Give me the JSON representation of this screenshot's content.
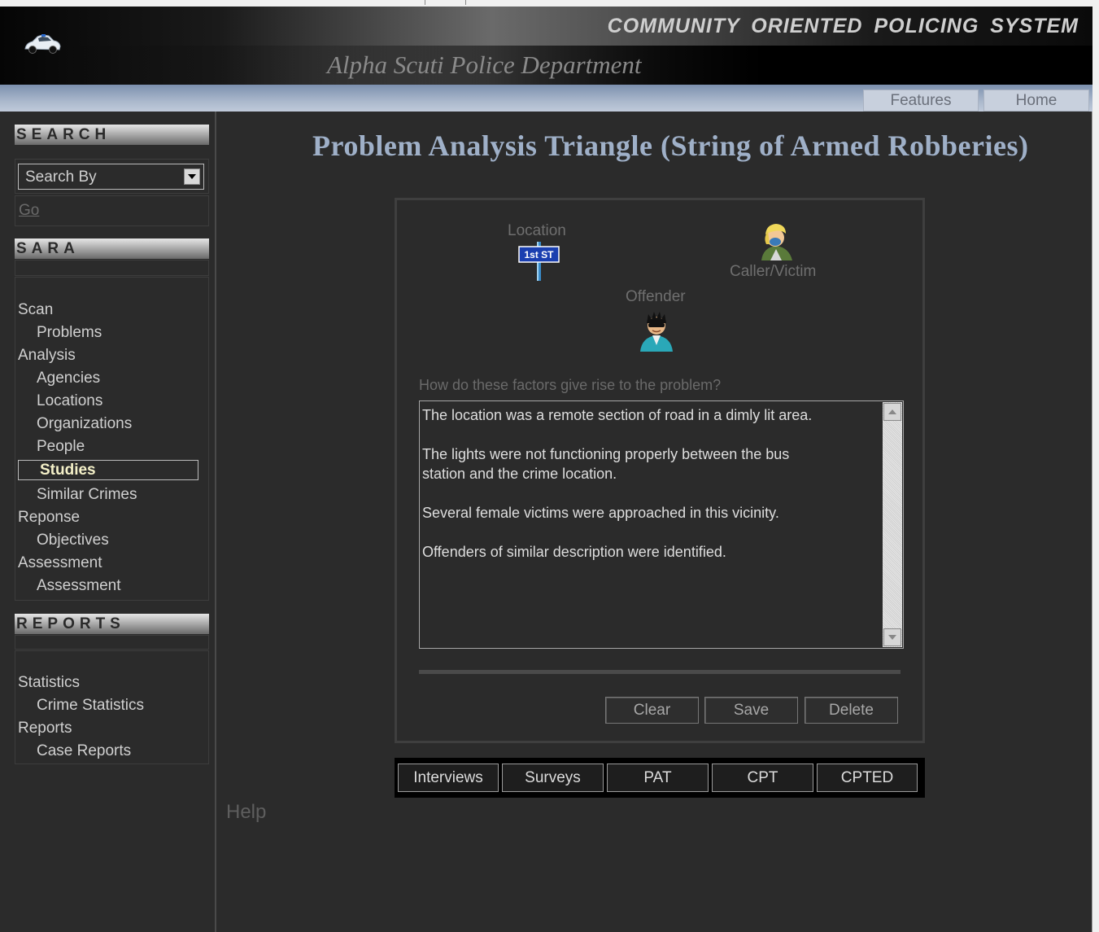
{
  "header": {
    "app_title": "COMMUNITY  ORIENTED  POLICING  SYSTEM",
    "department": "Alpha Scuti Police Department",
    "car_icon": "police-car-icon"
  },
  "nav": {
    "features": "Features",
    "home": "Home"
  },
  "sidebar": {
    "search_heading": "SEARCH",
    "search_select_value": "Search By",
    "go_label": "Go",
    "sara_heading": "SARA",
    "sara_items": [
      {
        "label": "Scan",
        "level": 0
      },
      {
        "label": "Problems",
        "level": 1
      },
      {
        "label": "Analysis",
        "level": 0
      },
      {
        "label": "Agencies",
        "level": 1
      },
      {
        "label": "Locations",
        "level": 1
      },
      {
        "label": "Organizations",
        "level": 1
      },
      {
        "label": "People",
        "level": 1
      },
      {
        "label": "Studies",
        "level": 1,
        "active": true
      },
      {
        "label": "Similar Crimes",
        "level": 1
      },
      {
        "label": "Reponse",
        "level": 0
      },
      {
        "label": "Objectives",
        "level": 1
      },
      {
        "label": "Assessment",
        "level": 0
      },
      {
        "label": "Assessment",
        "level": 1
      }
    ],
    "reports_heading": "REPORTS",
    "report_items": [
      {
        "label": "Statistics",
        "level": 0
      },
      {
        "label": "Crime Statistics",
        "level": 1
      },
      {
        "label": "Reports",
        "level": 0
      },
      {
        "label": "Case Reports",
        "level": 1
      }
    ]
  },
  "main": {
    "title": "Problem Analysis Triangle (String of Armed Robberies)",
    "triangle": {
      "location_label": "Location",
      "location_sign": "1st ST",
      "victim_label": "Caller/Victim",
      "offender_label": "Offender"
    },
    "question": "How do these factors give rise to the problem?",
    "answer_paragraphs": [
      "The location was a remote section of road in a dimly lit area.",
      "The lights were not functioning properly between the bus\nstation and the crime location.",
      "Several female victims were approached in this vicinity.",
      "Offenders of similar description were identified."
    ],
    "buttons": {
      "clear": "Clear",
      "save": "Save",
      "delete": "Delete"
    },
    "study_tabs": [
      "Interviews",
      "Surveys",
      "PAT",
      "CPT",
      "CPTED"
    ],
    "help": "Help"
  },
  "colors": {
    "background": "#2b2b2b",
    "title": "#9fb0c8",
    "nav_bar": "#a9b7cb",
    "active_item_text": "#f4f0c8"
  }
}
